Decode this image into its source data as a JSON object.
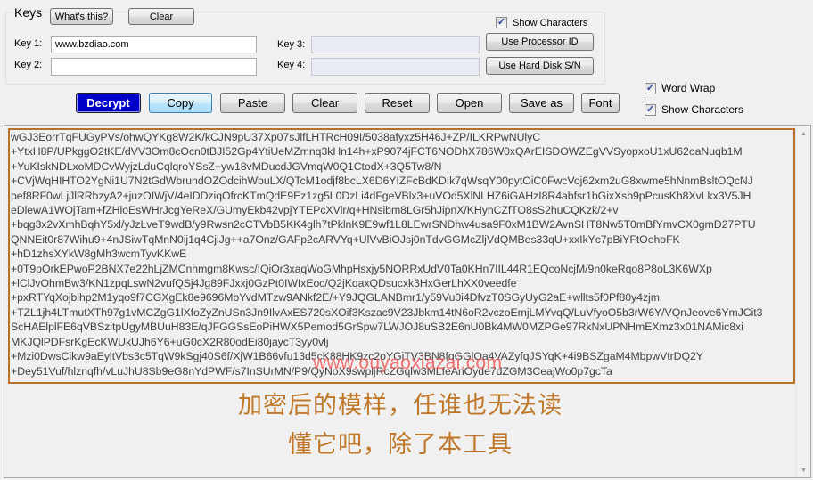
{
  "keys_panel": {
    "title": "Keys",
    "whats_this_label": "What's this?",
    "clear_label": "Clear",
    "show_characters_label": "Show Characters",
    "show_characters_checked": true,
    "key1_label": "Key 1:",
    "key1_value": "www.bzdiao.com",
    "key2_label": "Key 2:",
    "key2_value": "",
    "key3_label": "Key 3:",
    "key3_value": "",
    "key4_label": "Key 4:",
    "key4_value": "",
    "use_processor_id_label": "Use Processor ID",
    "use_hard_disk_label": "Use Hard Disk S/N"
  },
  "toolbar": {
    "decrypt_label": "Decrypt",
    "copy_label": "Copy",
    "paste_label": "Paste",
    "clear_label": "Clear",
    "reset_label": "Reset",
    "open_label": "Open",
    "save_as_label": "Save as",
    "font_label": "Font"
  },
  "options": {
    "word_wrap_label": "Word Wrap",
    "word_wrap_checked": true,
    "show_characters_label": "Show Characters",
    "show_characters_checked": true
  },
  "editor": {
    "cipher_lines": [
      "wGJ3EorrTqFUGyPVs/ohwQYKg8W2K/kCJN9pU37Xp07sJlfLHTRcH09I/5038afyxz5H46J+ZP/ILKRPwNUlyC",
      "+YtxH8P/UPkggO2tKE/dVV3Om8cOcn0tBJI52Gp4YtiUeMZmnq3kHn14h+xP9074jFCT6NODhX786W0xQArEISDOWZEgVVSyopxoU1xU62oaNuqb1M",
      "+YuKIskNDLxoMDCvWyjzLduCqlqroYSsZ+yw18vMDucdJGVmqW0Q1CtodX+3Q5Tw8/N",
      "+CVjWqHIHTO2YgNi1U7N2tGdWbrundOZOdcihWbuLX/QTcM1odjf8bcLX6D6YIZFcBdKDIk7qWsqY00pytOiC0FwcVoj62xm2uG8xwme5hNnmBsltOQcNJ",
      "pef8RF0wLjJlRRbzyA2+juzOIWjV/4eIDDziqOfrcKTmQdE9Ez1zg5L0DzLi4dFgeVBlx3+uVOd5XlNLHZ6iGAHzI8R4abfsr1bGixXsb9pPcusKh8XvLkx3V5JH",
      "eDlewA1WOjTam+fZHloEsWHrJcgYeReX/GUmyEkb42vpjYTEPcXVlr/q+HNsibm8LGr5hJipnX/KHynCZfTO8sS2huCQKzk/2+v",
      "+bqg3x2vXmhBqhY5xl/yJzLveT9wdB/y9Rwsn2cCTVbB5KK4glh7tPklnK9E9wf1L8LEwrSNDhw4usa9F0xM1BW2AvnSHT8Nw5T0mBfYmvCX0gmD27PTU",
      "QNNEit0r87Wihu9+4nJSiwTqMnN0ij1q4CjlJg++a7Onz/GAFp2cARVYq+UlVvBiOJsj0nTdvGGMcZljVdQMBes33qU+xxIkYc7pBiYFtOehoFK",
      "+hD1zhsXYkW8gMh3wcmTyvKKwE",
      "+0T9pOrkEPwoP2BNX7e22hLjZMCnhmgm8Kwsc/IQiOr3xaqWoGMhpHsxjy5NORRxUdV0Ta0KHn7IIL44R1EQcoNcjM/9n0keRqo8P8oL3K6WXp",
      "+lClJvOhmBw3/KN1zpqLswN2vufQSj4Jg89FJxxj0GzPt0IWIxEoc/Q2jKqaxQDsucxk3HxGerLhXX0veedfe",
      "+pxRTYqXojbihp2M1yqo9f7CGXgEk8e9696MbYvdMTzw9ANkf2E/+Y9JQGLANBmr1/y59Vu0i4DfvzT0SGyUyG2aE+wllts5f0Pf80y4zjm",
      "+TZL1jh4LTmutXTh97g1vMCZgG1lXfoZyZnUSn3Jn9IlvAxES720sXOif3Kszac9V23Jbkm14tN6oR2vczoEmjLMYvqQ/LuVfyoO5b3rW6Y/VQnJeove6YmJCit3",
      "ScHAElplFE6qVBSzitpUgyMBUuH83E/qJFGGSsEoPiHWX5Pemod5GrSpw7LWJOJ8uSB2E6nU0Bk4MW0MZPGe97RkNxUPNHmEXmz3x01NAMic8xi",
      "MKJQlPDFsrKgEcKWUkUJh6Y6+uG0cX2R80odEi80jaycT3yy0vlj",
      "+Mzi0DwsCikw9aEyltVbs3c5TqW9kSgj40S6f/XjW1B66vfu13d5cK88HK9zc2oYGjTV3BN8fqGGlOa4VAZyfqJSYqK+4i9BSZgaM4MbpwVtrDQ2Y",
      "+Dey51Vuf/hlznqfh/vLuJhU8Sb9eG8nYdPWF/s7InSUrMN/P9/QyNoX9swpljRcZGqlw3MLfeAnOyde7dZGM3CeajWo0p7gcTa"
    ],
    "watermark": "www.ouyaoxiazai.com",
    "caption_line1": "加密后的模样，任谁也无法读",
    "caption_line2": "懂它吧，除了本工具"
  }
}
